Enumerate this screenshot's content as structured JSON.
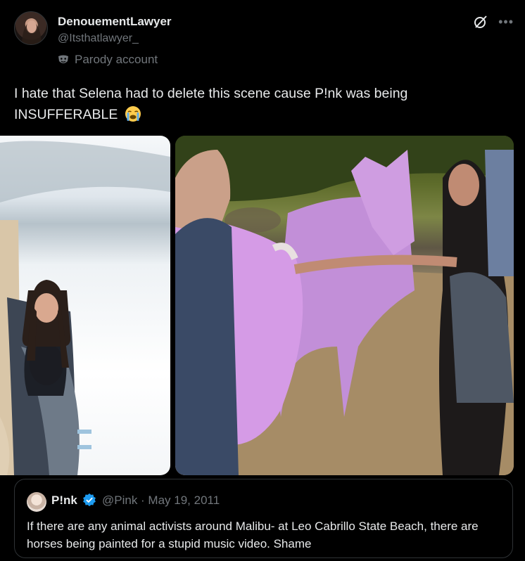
{
  "author": {
    "name": "DenouementLawyer",
    "handle": "@Itsthatlawyer_",
    "label": "Parody account"
  },
  "tweet": {
    "text": "I hate that Selena had to delete this scene cause P!nk was being INSUFFERABLE",
    "emoji": "loudly-crying-face"
  },
  "media": {
    "count": 2
  },
  "quoted": {
    "name": "P!nk",
    "handle": "@Pink",
    "date": "May 19, 2011",
    "meta": "@Pink · May 19, 2011",
    "text": "If there are any animal activists around Malibu- at Leo Cabrillo State Beach, there are horses being painted for a stupid music video. Shame"
  },
  "colors": {
    "background": "#000000",
    "text": "#e7e9ea",
    "secondary": "#71767b",
    "border": "#2f3336",
    "verified": "#1d9bf0",
    "pink_horse": "#d59be6"
  },
  "icons": [
    "grok-icon",
    "more-icon",
    "parody-mask-icon",
    "verified-badge-icon"
  ]
}
